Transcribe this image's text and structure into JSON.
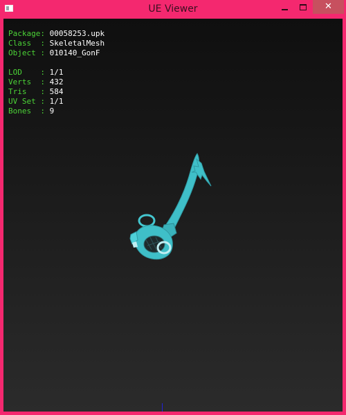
{
  "window": {
    "title": "UE Viewer",
    "controls": {
      "minimize_icon": "minimize-icon",
      "maximize_icon": "maximize-icon",
      "close_glyph": "✕"
    }
  },
  "info": {
    "package": {
      "key": "Package:",
      "value": "00058253.upk"
    },
    "class": {
      "key": "Class  :",
      "value": "SkeletalMesh"
    },
    "object": {
      "key": "Object :",
      "value": "010140_GonF"
    },
    "lod": {
      "key": "LOD    :",
      "value": "1/1"
    },
    "verts": {
      "key": "Verts  :",
      "value": "432"
    },
    "tris": {
      "key": "Tris   :",
      "value": "584"
    },
    "uvset": {
      "key": "UV Set :",
      "value": "1/1"
    },
    "bones": {
      "key": "Bones  :",
      "value": "9"
    }
  },
  "colors": {
    "frame": "#f4286f",
    "close_button": "#c7505f",
    "label": "#4cd437",
    "value": "#ffffff",
    "mesh": "#3fbfc8"
  }
}
